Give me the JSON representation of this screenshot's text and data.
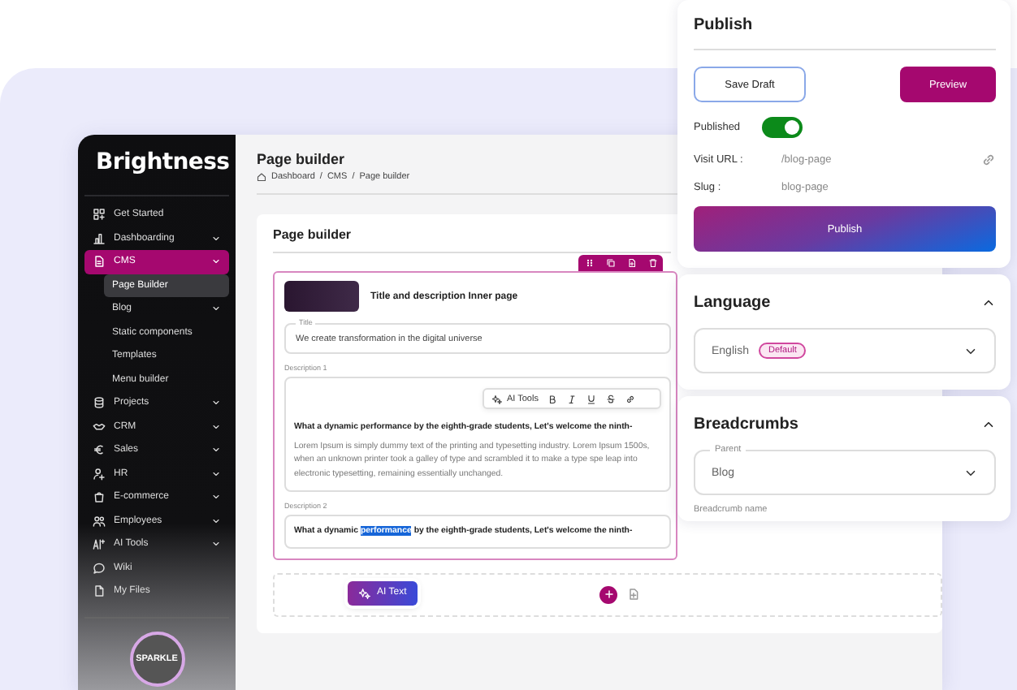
{
  "sidebar": {
    "logo": "Brightness",
    "items": [
      {
        "label": "Get Started",
        "has_submenu": false,
        "selected": false
      },
      {
        "label": "Dashboarding",
        "has_submenu": true,
        "selected": false
      },
      {
        "label": "CMS",
        "has_submenu": true,
        "selected": true,
        "children": [
          {
            "label": "Page Builder",
            "has_submenu": false,
            "selected": true
          },
          {
            "label": "Blog",
            "has_submenu": true,
            "selected": false
          },
          {
            "label": "Static components",
            "has_submenu": false,
            "selected": false
          },
          {
            "label": "Templates",
            "has_submenu": false,
            "selected": false
          },
          {
            "label": "Menu builder",
            "has_submenu": false,
            "selected": false
          }
        ]
      },
      {
        "label": "Projects",
        "has_submenu": true,
        "selected": false
      },
      {
        "label": "CRM",
        "has_submenu": true,
        "selected": false
      },
      {
        "label": "Sales",
        "has_submenu": true,
        "selected": false
      },
      {
        "label": "HR",
        "has_submenu": true,
        "selected": false
      },
      {
        "label": "E-commerce",
        "has_submenu": true,
        "selected": false
      },
      {
        "label": "Employees",
        "has_submenu": true,
        "selected": false
      },
      {
        "label": "AI Tools",
        "has_submenu": true,
        "selected": false
      },
      {
        "label": "Wiki",
        "has_submenu": false,
        "selected": false
      },
      {
        "label": "My Files",
        "has_submenu": false,
        "selected": false
      }
    ],
    "badge": "SPARKLE"
  },
  "main": {
    "title": "Page builder",
    "breadcrumb": [
      "Dashboard",
      "CMS",
      "Page builder"
    ],
    "breadcrumb_separator": "/",
    "card_title": "Page builder",
    "block": {
      "title": "Title and description Inner page",
      "title_field": {
        "label": "Title",
        "value": "We create transformation in the digital universe"
      },
      "description_1": {
        "label": "Description 1",
        "ai_tools": "AI Tools",
        "heading": "What a dynamic performance by the eighth-grade students, Let's welcome the ninth-",
        "body": "Lorem Ipsum is simply dummy text of the printing and  typesetting industry. Lorem Ipsum 1500s, when an unknown printer took a galley of  type and scrambled it to make a type spe leap into electronic typesetting,  remaining essentially unchanged."
      },
      "description_2": {
        "label": "Description 2",
        "before": "What a dynamic ",
        "selection": "performance",
        "after": " by the eighth-grade students, Let's welcome the ninth-"
      }
    },
    "ai_text": "AI Text"
  },
  "publish": {
    "title": "Publish",
    "save_draft": "Save Draft",
    "preview": "Preview",
    "published": {
      "label": "Published",
      "on": true
    },
    "visit_url": {
      "label": "Visit URL :",
      "value": "/blog-page"
    },
    "slug": {
      "label": "Slug :",
      "value": "blog-page"
    },
    "button": "Publish"
  },
  "language": {
    "title": "Language",
    "expanded": true,
    "value": "English",
    "badge": "Default"
  },
  "breadcrumbs": {
    "title": "Breadcrumbs",
    "expanded": true,
    "parent": {
      "label": "Parent",
      "value": "Blog"
    },
    "name_label": "Breadcrumb name"
  }
}
